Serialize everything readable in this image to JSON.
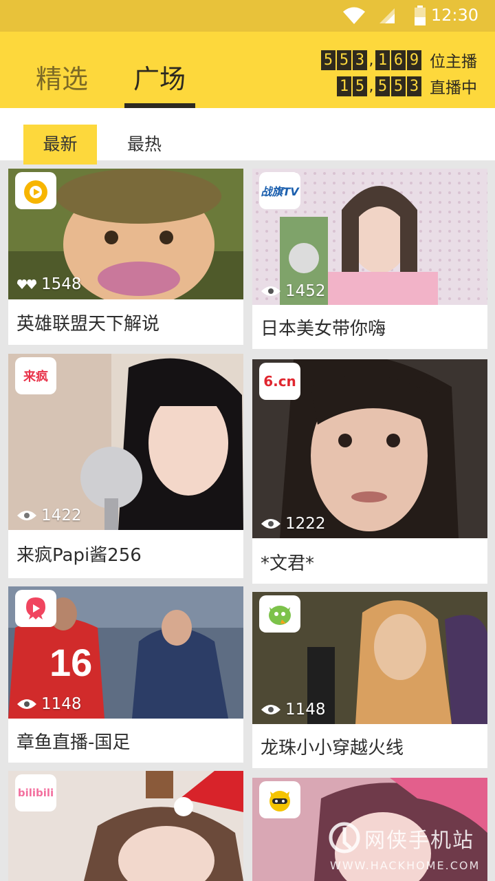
{
  "status_bar": {
    "time": "12:30"
  },
  "header": {
    "tabs": [
      {
        "label": "精选",
        "active": false
      },
      {
        "label": "广场",
        "active": true
      }
    ],
    "counters": [
      {
        "digits": [
          "5",
          "5",
          "3",
          ",",
          "1",
          "6",
          "9"
        ],
        "label": "位主播"
      },
      {
        "digits": [
          "1",
          "5",
          ",",
          "5",
          "5",
          "3"
        ],
        "label": "直播中"
      }
    ]
  },
  "sub_tabs": [
    {
      "label": "最新",
      "active": true
    },
    {
      "label": "最热",
      "active": false
    }
  ],
  "cards": [
    {
      "platform": "douyu-logo",
      "viewers": "1548",
      "viewer_icon": "heart-icon",
      "title": "英雄联盟天下解说"
    },
    {
      "platform": "zhanqi-tv-logo",
      "viewers": "1452",
      "viewer_icon": "eye-icon",
      "title": "日本美女带你嗨"
    },
    {
      "platform": "laifeng-logo",
      "viewers": "1422",
      "viewer_icon": "eye-icon",
      "title": "来疯Papi酱256"
    },
    {
      "platform": "6cn-logo",
      "viewers": "1222",
      "viewer_icon": "eye-icon",
      "title": "*文君*"
    },
    {
      "platform": "zhangyu-logo",
      "viewers": "1148",
      "viewer_icon": "eye-icon",
      "title": "章鱼直播-国足"
    },
    {
      "platform": "longzhu-logo",
      "viewers": "1148",
      "viewer_icon": "eye-icon",
      "title": "龙珠小小穿越火线"
    },
    {
      "platform": "bilibili-logo",
      "viewers": "",
      "viewer_icon": "",
      "title": ""
    },
    {
      "platform": "yy-logo",
      "viewers": "",
      "viewer_icon": "",
      "title": ""
    }
  ],
  "logo_text": {
    "zhanqi": "战旗TV",
    "laifeng": "来疯",
    "six": "6.cn",
    "bilibili": "bilibili"
  },
  "watermark": {
    "line1": "网侠手机站",
    "line2": "WWW.HACKHOME.COM"
  },
  "colors": {
    "accent": "#fdd83c",
    "status": "#e8c23a",
    "dark": "#2d2a20"
  }
}
